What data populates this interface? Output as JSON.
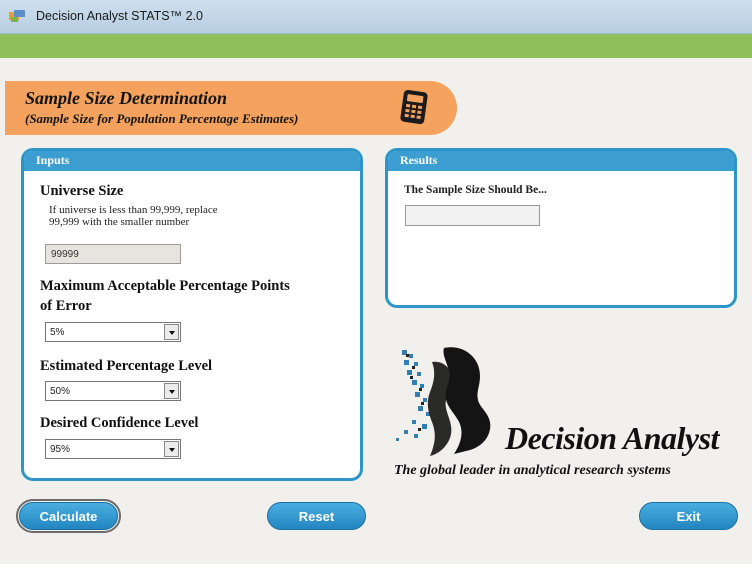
{
  "window": {
    "title": "Decision Analyst STATS™ 2.0"
  },
  "header": {
    "title": "Sample Size Determination",
    "subtitle": "(Sample Size for Population Percentage Estimates)",
    "icon": "calculator-icon"
  },
  "inputs": {
    "panel_title": "Inputs",
    "universe_size_label": "Universe Size",
    "universe_note_line1": "If universe is less than 99,999, replace",
    "universe_note_line2": "99,999 with the smaller number",
    "universe_size_value": "99999",
    "max_error_label_line1": "Maximum Acceptable Percentage Points",
    "max_error_label_line2": "of Error",
    "max_error_value": "5%",
    "estimated_pct_label": "Estimated Percentage Level",
    "estimated_pct_value": "50%",
    "confidence_label": "Desired Confidence Level",
    "confidence_value": "95%"
  },
  "results": {
    "panel_title": "Results",
    "label": "The Sample Size Should Be...",
    "value": ""
  },
  "logo": {
    "name": "Decision Analyst",
    "tagline": "The global leader in analytical research systems"
  },
  "buttons": {
    "calculate": "Calculate",
    "reset": "Reset",
    "exit": "Exit"
  },
  "colors": {
    "accent_blue": "#2e95c8",
    "banner_orange": "#f4a25e",
    "green_bar": "#8fbf5a"
  }
}
